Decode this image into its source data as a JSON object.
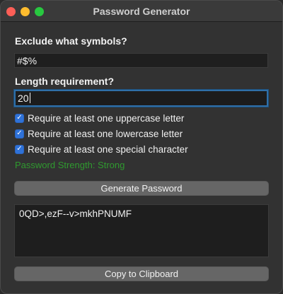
{
  "window": {
    "title": "Password Generator"
  },
  "exclude": {
    "label": "Exclude what symbols?",
    "value": "#$%"
  },
  "length": {
    "label": "Length requirement?",
    "value": "20"
  },
  "options": [
    {
      "label": "Require at least one uppercase letter",
      "checked": true
    },
    {
      "label": "Require at least one lowercase letter",
      "checked": true
    },
    {
      "label": "Require at least one special character",
      "checked": true
    }
  ],
  "strength": {
    "text": "Password Strength: Strong",
    "color": "#2f9a2f"
  },
  "generate_button": {
    "label": "Generate Password"
  },
  "output": {
    "value": "0QD>,ezF--v>mkhPNUMF"
  },
  "copy_button": {
    "label": "Copy to Clipboard"
  },
  "colors": {
    "accent": "#2f72d8",
    "close": "#fe5f57",
    "minimize": "#febc2e",
    "maximize": "#28c840"
  }
}
